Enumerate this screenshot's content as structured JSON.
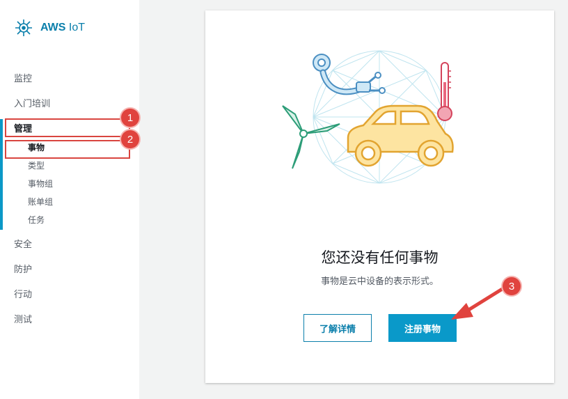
{
  "brand": {
    "name_bold": "AWS",
    "name_light": "IoT",
    "icon": "aws-iot-icon"
  },
  "nav": {
    "monitor": "监控",
    "onboard": "入门培训",
    "manage": "管理",
    "manage_items": [
      "事物",
      "类型",
      "事物组",
      "账单组",
      "任务"
    ],
    "secure": "安全",
    "defend": "防护",
    "act": "行动",
    "test": "测试"
  },
  "annotations": {
    "one": "1",
    "two": "2",
    "three": "3"
  },
  "empty_state": {
    "title": "您还没有任何事物",
    "subtitle": "事物是云中设备的表示形式。",
    "learn_more": "了解详情",
    "register": "注册事物"
  },
  "colors": {
    "accent": "#0b7fab",
    "primary_button": "#0a99c9",
    "active_bar": "#0b98c7",
    "annotation_red": "#e0433e"
  }
}
